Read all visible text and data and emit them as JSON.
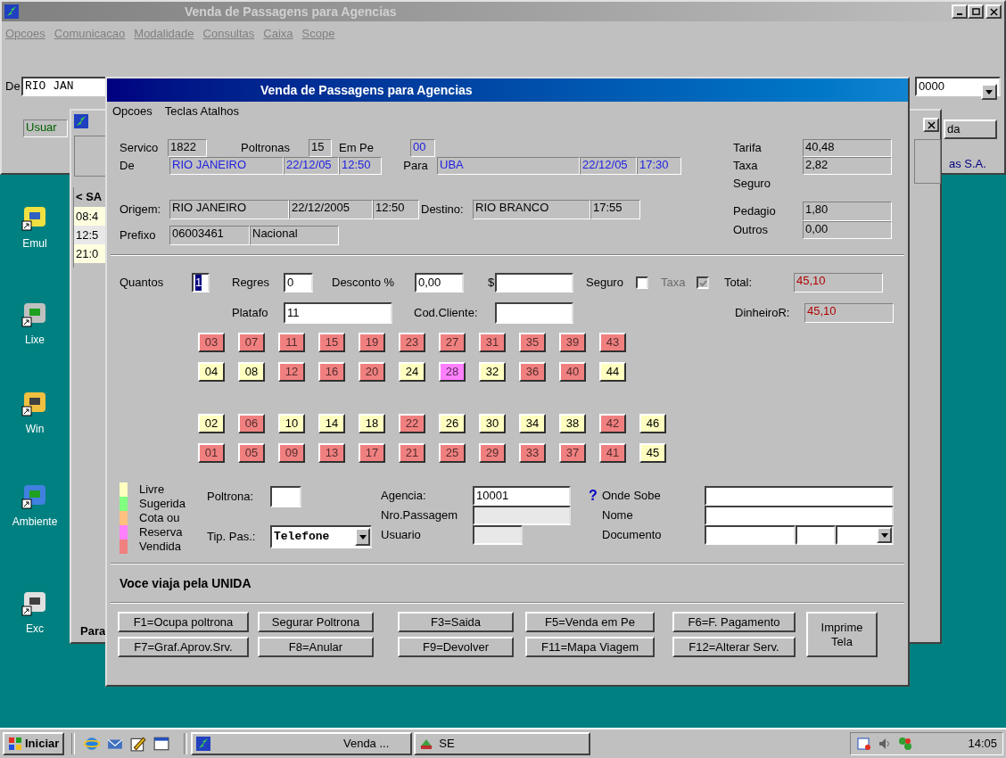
{
  "desktop_icons": [
    {
      "label": "Emul"
    },
    {
      "label": "Lixe"
    },
    {
      "label": "Win"
    },
    {
      "label": "Ambiente"
    },
    {
      "label": "Exc"
    }
  ],
  "back_window": {
    "title": "Venda de Passagens para Agencias",
    "menu": [
      "Opcoes",
      "Comunicacao",
      "Modalidade",
      "Consultas",
      "Caixa",
      "Scope"
    ],
    "de_label": "De",
    "de_value": "RIO JAN",
    "combo_value": "0000",
    "usuario_value": "Usuar",
    "button_label": "da",
    "company": "as S.A."
  },
  "schedule_window": {
    "list_header": "< SA",
    "times": [
      "08:4",
      "12:5",
      "21:0"
    ],
    "footer_label": "Para"
  },
  "dialog": {
    "title": "Venda de Passagens para Agencias",
    "menu": [
      "Opcoes",
      "Teclas Atalhos"
    ],
    "servico": {
      "label": "Servico",
      "value": "1822"
    },
    "poltronas": {
      "label": "Poltronas",
      "value": "15"
    },
    "em_pe": {
      "label": "Em Pe",
      "value": "00"
    },
    "de": {
      "label": "De",
      "city": "RIO JANEIRO",
      "date": "22/12/05",
      "time": "12:50"
    },
    "para": {
      "label": "Para",
      "city": "UBA",
      "date": "22/12/05",
      "time": "17:30"
    },
    "origem": {
      "label": "Origem:",
      "city": "RIO JANEIRO",
      "date": "22/12/2005",
      "time": "12:50"
    },
    "destino": {
      "label": "Destino:",
      "city": "RIO BRANCO",
      "time": "17:55"
    },
    "prefixo": {
      "label": "Prefixo",
      "code": "06003461",
      "type": "Nacional"
    },
    "charges": [
      {
        "label": "Tarifa",
        "value": "40,48"
      },
      {
        "label": "Taxa",
        "value": "2,82"
      },
      {
        "label": "Seguro"
      },
      {
        "label": "Pedagio",
        "value": "1,80"
      },
      {
        "label": "Outros",
        "value": "0,00"
      }
    ],
    "quantos": {
      "label": "Quantos",
      "value": "1",
      "selected": true
    },
    "regres": {
      "label": "Regres",
      "value": "0"
    },
    "desconto": {
      "label": "Desconto %",
      "value": "0,00"
    },
    "valor": {
      "label": "$"
    },
    "seguro": {
      "label": "Seguro",
      "checked": false,
      "disabled": false
    },
    "taxa": {
      "label": "Taxa",
      "checked": true,
      "disabled": true
    },
    "total": {
      "label": "Total:",
      "value": "45,10"
    },
    "platafo": {
      "label": "Platafo",
      "value": "11"
    },
    "cod_cliente": {
      "label": "Cod.Cliente:"
    },
    "dinheiro": {
      "label": "DinheiroR:",
      "value": "45,10"
    },
    "seat_rows": [
      [
        {
          "number": "03",
          "color": "#f08080"
        },
        {
          "number": "07",
          "color": "#f08080"
        },
        {
          "number": "11",
          "color": "#f08080"
        },
        {
          "number": "15",
          "color": "#f08080"
        },
        {
          "number": "19",
          "color": "#f08080"
        },
        {
          "number": "23",
          "color": "#f08080"
        },
        {
          "number": "27",
          "color": "#f08080"
        },
        {
          "number": "31",
          "color": "#f08080"
        },
        {
          "number": "35",
          "color": "#f08080"
        },
        {
          "number": "39",
          "color": "#f08080"
        },
        {
          "number": "43",
          "color": "#f08080"
        }
      ],
      [
        {
          "number": "04",
          "color": "#ffffc0"
        },
        {
          "number": "08",
          "color": "#ffffc0"
        },
        {
          "number": "12",
          "color": "#f08080"
        },
        {
          "number": "16",
          "color": "#f08080"
        },
        {
          "number": "20",
          "color": "#f08080"
        },
        {
          "number": "24",
          "color": "#ffffc0"
        },
        {
          "number": "28",
          "color": "#ff80ff"
        },
        {
          "number": "32",
          "color": "#ffffc0"
        },
        {
          "number": "36",
          "color": "#f08080"
        },
        {
          "number": "40",
          "color": "#f08080"
        },
        {
          "number": "44",
          "color": "#ffffc0"
        }
      ],
      [
        {
          "number": "02",
          "color": "#ffffc0"
        },
        {
          "number": "06",
          "color": "#f08080"
        },
        {
          "number": "10",
          "color": "#ffffc0"
        },
        {
          "number": "14",
          "color": "#ffffc0"
        },
        {
          "number": "18",
          "color": "#ffffc0"
        },
        {
          "number": "22",
          "color": "#f08080"
        },
        {
          "number": "26",
          "color": "#ffffc0"
        },
        {
          "number": "30",
          "color": "#ffffc0"
        },
        {
          "number": "34",
          "color": "#ffffc0"
        },
        {
          "number": "38",
          "color": "#ffffc0"
        },
        {
          "number": "42",
          "color": "#f08080"
        },
        {
          "number": "46",
          "color": "#ffffc0"
        }
      ],
      [
        {
          "number": "01",
          "color": "#f08080"
        },
        {
          "number": "05",
          "color": "#f08080"
        },
        {
          "number": "09",
          "color": "#f08080"
        },
        {
          "number": "13",
          "color": "#f08080"
        },
        {
          "number": "17",
          "color": "#f08080"
        },
        {
          "number": "21",
          "color": "#f08080"
        },
        {
          "number": "25",
          "color": "#f08080"
        },
        {
          "number": "29",
          "color": "#f08080"
        },
        {
          "number": "33",
          "color": "#f08080"
        },
        {
          "number": "37",
          "color": "#f08080"
        },
        {
          "number": "41",
          "color": "#f08080"
        },
        {
          "number": "45",
          "color": "#ffffc0"
        }
      ]
    ],
    "legend": [
      {
        "label": "Livre",
        "color": "#ffffc0"
      },
      {
        "label": "Sugerida",
        "color": "#80ff80"
      },
      {
        "label": "Cota ou",
        "color": "#ffc080"
      },
      {
        "label": "Reserva",
        "color": "#ff80ff"
      },
      {
        "label": "Vendida",
        "color": "#f08080"
      }
    ],
    "poltrona": {
      "label": "Poltrona:"
    },
    "tip_pas": {
      "label": "Tip. Pas.:",
      "value": "Telefone"
    },
    "agencia": {
      "label": "Agencia:",
      "value": "10001"
    },
    "nro_passagem": {
      "label": "Nro.Passagem"
    },
    "usuario": {
      "label": "Usuario"
    },
    "help_mark": "?",
    "onde_sobe": {
      "label": "Onde Sobe"
    },
    "nome": {
      "label": "Nome"
    },
    "documento": {
      "label": "Documento"
    },
    "message": "Voce viaja pela UNIDA",
    "buttons": [
      [
        "F1=Ocupa poltrona",
        "Segurar Poltrona",
        "F3=Saida",
        "F5=Venda em Pe",
        "F6=F. Pagamento"
      ],
      [
        "F7=Graf.Aprov.Srv.",
        "F8=Anular",
        "F9=Devolver",
        "F11=Mapa Viagem",
        "F12=Alterar Serv."
      ]
    ],
    "print_button": "Imprime Tela"
  },
  "taskbar": {
    "start": "Iniciar",
    "tasks": [
      {
        "label": "Venda ..."
      },
      {
        "label": "SE"
      }
    ],
    "clock": "14:05"
  }
}
